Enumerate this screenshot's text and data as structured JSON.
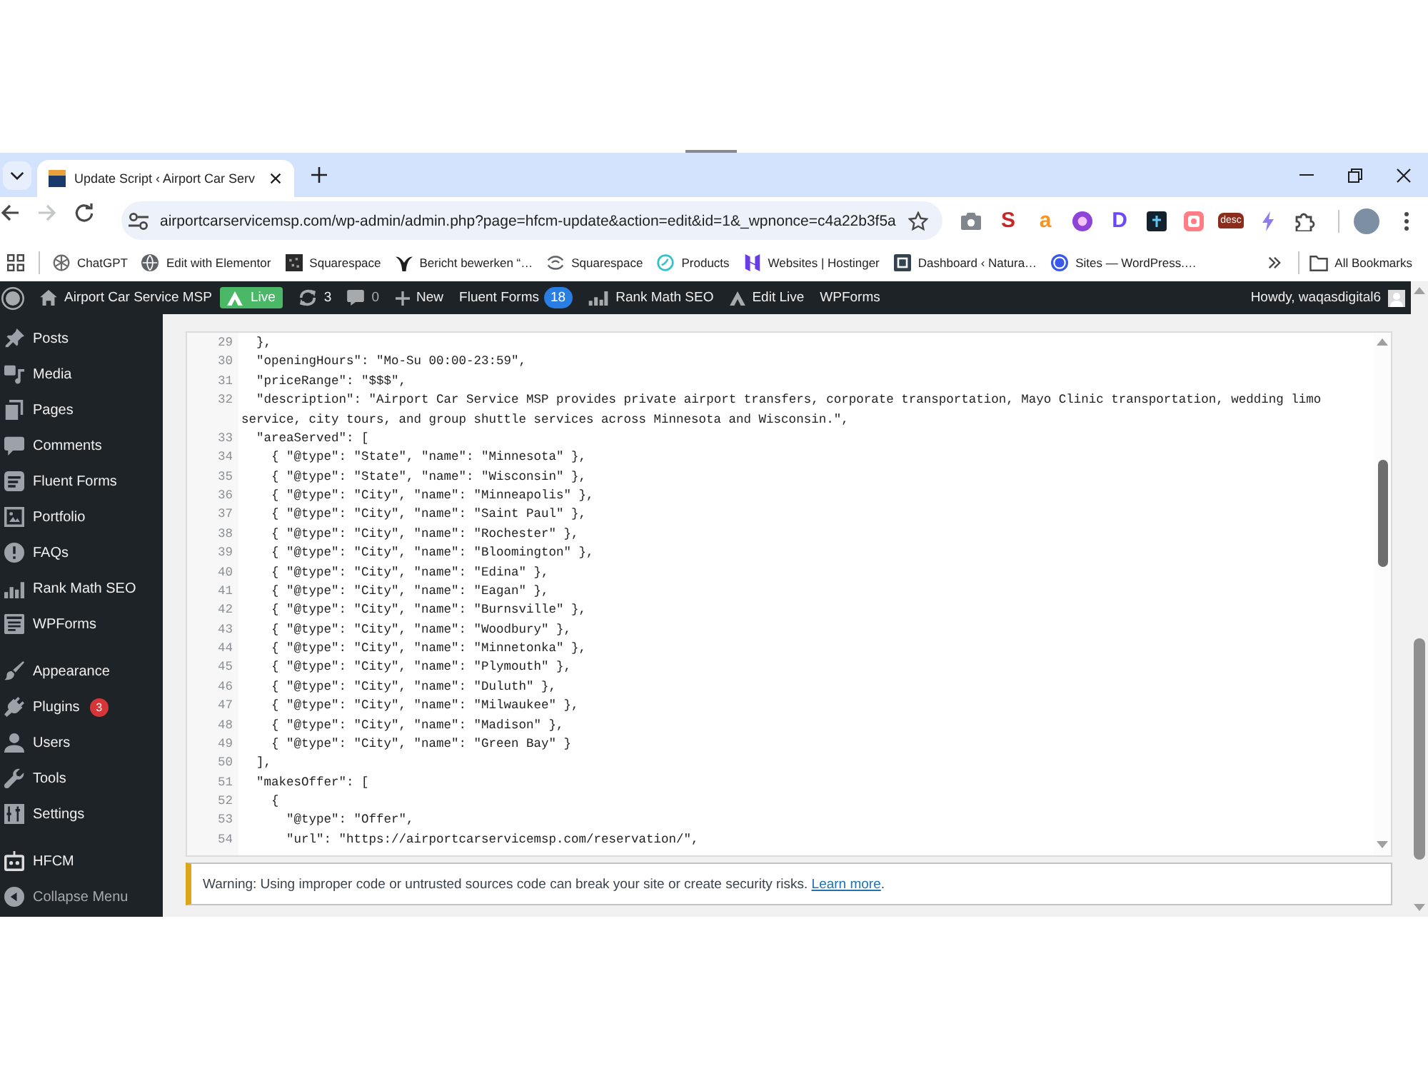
{
  "browser": {
    "tabs": [
      {
        "title": "Update Script ‹ Airport Car Serv",
        "selected": true
      }
    ],
    "nav_buttons": [
      {
        "kind": "back",
        "disabled": false
      },
      {
        "kind": "forward",
        "disabled": true
      },
      {
        "kind": "reload",
        "disabled": false
      }
    ],
    "address": "airportcarservicemsp.com/wp-admin/admin.php?page=hfcm-update&action=edit&id=1&_wpnonce=c4a22b3f5a",
    "extensions": [
      {
        "kind": "camera"
      },
      {
        "kind": "letter",
        "glyph": "S",
        "color": "#c62828"
      },
      {
        "kind": "letter",
        "glyph": "a",
        "color": "#f7931e"
      },
      {
        "kind": "orb"
      },
      {
        "kind": "letter",
        "glyph": "D",
        "color": "#6c47ff"
      },
      {
        "kind": "tile"
      },
      {
        "kind": "frame"
      },
      {
        "kind": "badge",
        "glyph": "desc"
      },
      {
        "kind": "bolt"
      },
      {
        "kind": "puzzle"
      }
    ],
    "bookmarks": [
      {
        "kind": "knot",
        "label": "ChatGPT"
      },
      {
        "kind": "globe",
        "label": "Edit with Elementor"
      },
      {
        "kind": "tile",
        "label": "Squarespace"
      },
      {
        "kind": "fork",
        "label": "Bericht bewerken “…"
      },
      {
        "kind": "swirl",
        "label": "Squarespace"
      },
      {
        "kind": "leaf",
        "label": "Products"
      },
      {
        "kind": "hmark",
        "label": "Websites | Hostinger"
      },
      {
        "kind": "nsquare",
        "label": "Dashboard ‹ Natura…"
      },
      {
        "kind": "wcircle",
        "label": "Sites — WordPress.…"
      }
    ],
    "all_bookmarks": "All Bookmarks"
  },
  "admin_bar": {
    "items": [
      {
        "kind": "logo"
      },
      {
        "kind": "home",
        "label": "Airport Car Service MSP"
      },
      {
        "kind": "live",
        "label": "Live"
      },
      {
        "kind": "updates",
        "label": "3"
      },
      {
        "kind": "comments",
        "label": "0"
      },
      {
        "kind": "new",
        "label": "New"
      },
      {
        "kind": "text",
        "label": "Fluent Forms",
        "count": "18"
      },
      {
        "kind": "rankmath",
        "label": "Rank Math SEO"
      },
      {
        "kind": "editlive",
        "label": "Edit Live"
      },
      {
        "kind": "text",
        "label": "WPForms"
      }
    ],
    "greeting": "Howdy, waqasdigital6"
  },
  "sidebar": {
    "groups": [
      {
        "items": [
          {
            "kind": "pin",
            "label": "Posts"
          },
          {
            "kind": "media",
            "label": "Media"
          },
          {
            "kind": "pages",
            "label": "Pages"
          },
          {
            "kind": "comment",
            "label": "Comments"
          },
          {
            "kind": "form",
            "label": "Fluent Forms"
          },
          {
            "kind": "portfolio",
            "label": "Portfolio"
          },
          {
            "kind": "alert",
            "label": "FAQs"
          },
          {
            "kind": "chart",
            "label": "Rank Math SEO"
          },
          {
            "kind": "wpforms",
            "label": "WPForms"
          }
        ]
      },
      {
        "items": [
          {
            "kind": "brush",
            "label": "Appearance"
          },
          {
            "kind": "plug",
            "label": "Plugins",
            "count": "3"
          },
          {
            "kind": "user",
            "label": "Users"
          },
          {
            "kind": "wrench",
            "label": "Tools"
          },
          {
            "kind": "sliders",
            "label": "Settings"
          }
        ]
      },
      {
        "items": [
          {
            "kind": "robot",
            "label": "HFCM"
          },
          {
            "kind": "collapse",
            "label": "Collapse Menu"
          }
        ]
      }
    ]
  },
  "editor": {
    "lines": [
      {
        "number": "29",
        "code": "  },"
      },
      {
        "number": "30",
        "code": "  \"openingHours\": \"Mo-Su 00:00-23:59\","
      },
      {
        "number": "31",
        "code": "  \"priceRange\": \"$$$\","
      },
      {
        "number": "32",
        "code": "  \"description\": \"Airport Car Service MSP provides private airport transfers, corporate transportation, Mayo Clinic transportation, wedding limo service, city tours, and group shuttle services across Minnesota and Wisconsin.\","
      },
      {
        "number": "33",
        "code": "  \"areaServed\": ["
      },
      {
        "number": "34",
        "code": "    { \"@type\": \"State\", \"name\": \"Minnesota\" },"
      },
      {
        "number": "35",
        "code": "    { \"@type\": \"State\", \"name\": \"Wisconsin\" },"
      },
      {
        "number": "36",
        "code": "    { \"@type\": \"City\", \"name\": \"Minneapolis\" },"
      },
      {
        "number": "37",
        "code": "    { \"@type\": \"City\", \"name\": \"Saint Paul\" },"
      },
      {
        "number": "38",
        "code": "    { \"@type\": \"City\", \"name\": \"Rochester\" },"
      },
      {
        "number": "39",
        "code": "    { \"@type\": \"City\", \"name\": \"Bloomington\" },"
      },
      {
        "number": "40",
        "code": "    { \"@type\": \"City\", \"name\": \"Edina\" },"
      },
      {
        "number": "41",
        "code": "    { \"@type\": \"City\", \"name\": \"Eagan\" },"
      },
      {
        "number": "42",
        "code": "    { \"@type\": \"City\", \"name\": \"Burnsville\" },"
      },
      {
        "number": "43",
        "code": "    { \"@type\": \"City\", \"name\": \"Woodbury\" },"
      },
      {
        "number": "44",
        "code": "    { \"@type\": \"City\", \"name\": \"Minnetonka\" },"
      },
      {
        "number": "45",
        "code": "    { \"@type\": \"City\", \"name\": \"Plymouth\" },"
      },
      {
        "number": "46",
        "code": "    { \"@type\": \"City\", \"name\": \"Duluth\" },"
      },
      {
        "number": "47",
        "code": "    { \"@type\": \"City\", \"name\": \"Milwaukee\" },"
      },
      {
        "number": "48",
        "code": "    { \"@type\": \"City\", \"name\": \"Madison\" },"
      },
      {
        "number": "49",
        "code": "    { \"@type\": \"City\", \"name\": \"Green Bay\" }"
      },
      {
        "number": "50",
        "code": "  ],"
      },
      {
        "number": "51",
        "code": "  \"makesOffer\": ["
      },
      {
        "number": "52",
        "code": "    {"
      },
      {
        "number": "53",
        "code": "      \"@type\": \"Offer\","
      },
      {
        "number": "54",
        "code": "      \"url\": \"https://airportcarservicemsp.com/reservation/\","
      }
    ]
  },
  "notice": {
    "text": "Warning: Using improper code or untrusted sources code can break your site or create security risks.",
    "link": "Learn more",
    "after": "."
  }
}
